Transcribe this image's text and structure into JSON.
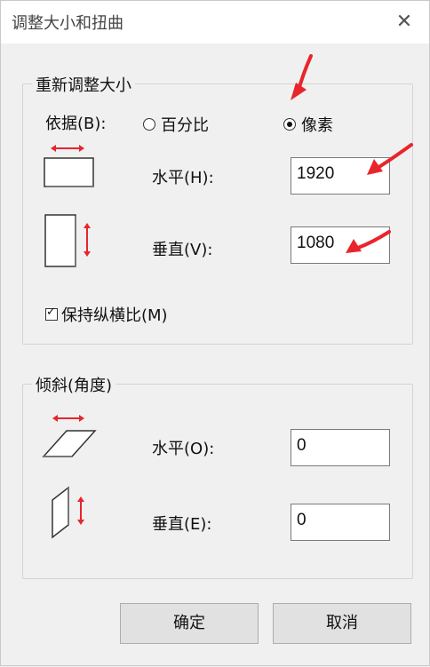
{
  "window": {
    "title": "调整大小和扭曲",
    "close_glyph": "✕"
  },
  "resize": {
    "title": "重新调整大小",
    "by_label": "依据(B):",
    "percent_label": "百分比",
    "pixels_label": "像素",
    "selected": "pixels",
    "horizontal_label": "水平(H):",
    "horizontal_value": "1920",
    "vertical_label": "垂直(V):",
    "vertical_value": "1080",
    "keep_ratio_label": "保持纵横比(M)",
    "keep_ratio_checked": true
  },
  "skew": {
    "title": "倾斜(角度)",
    "horizontal_label": "水平(O):",
    "horizontal_value": "0",
    "vertical_label": "垂直(E):",
    "vertical_value": "0"
  },
  "buttons": {
    "ok_label": "确定",
    "cancel_label": "取消"
  },
  "colors": {
    "accent_red": "#e8252b",
    "annotation_arrow": "#e8252b"
  },
  "icons": [
    "resize-horizontal-icon",
    "resize-vertical-icon",
    "skew-horizontal-icon",
    "skew-vertical-icon",
    "annotation-arrow-icon"
  ]
}
